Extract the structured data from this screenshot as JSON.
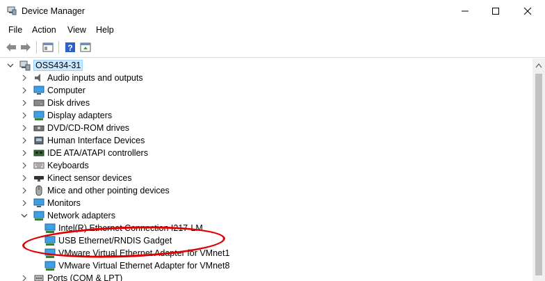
{
  "window": {
    "title": "Device Manager"
  },
  "menubar": {
    "items": [
      "File",
      "Action",
      "View",
      "Help"
    ]
  },
  "toolbar": {
    "buttons": [
      "back-arrow-icon",
      "forward-arrow-icon",
      "properties-icon",
      "help-icon",
      "update-driver-icon"
    ]
  },
  "tree": {
    "root": "OSS434-31",
    "categories": [
      {
        "label": "Audio inputs and outputs",
        "icon": "speaker-icon"
      },
      {
        "label": "Computer",
        "icon": "monitor-icon"
      },
      {
        "label": "Disk drives",
        "icon": "disk-drive-icon"
      },
      {
        "label": "Display adapters",
        "icon": "display-adapter-icon"
      },
      {
        "label": "DVD/CD-ROM drives",
        "icon": "dvd-icon"
      },
      {
        "label": "Human Interface Devices",
        "icon": "hid-icon"
      },
      {
        "label": "IDE ATA/ATAPI controllers",
        "icon": "ide-controller-icon"
      },
      {
        "label": "Keyboards",
        "icon": "keyboard-icon"
      },
      {
        "label": "Kinect sensor devices",
        "icon": "kinect-icon"
      },
      {
        "label": "Mice and other pointing devices",
        "icon": "mouse-icon"
      },
      {
        "label": "Monitors",
        "icon": "monitor-icon"
      },
      {
        "label": "Network adapters",
        "icon": "network-adapter-icon",
        "expanded": true
      }
    ],
    "network_children": [
      "Intel(R) Ethernet Connection I217-LM",
      "USB Ethernet/RNDIS Gadget",
      "VMware Virtual Ethernet Adapter for VMnet1",
      "VMware Virtual Ethernet Adapter for VMnet8"
    ],
    "after": {
      "label": "Ports (COM & LPT)",
      "icon": "port-icon"
    }
  },
  "highlight": {
    "color": "#e00000",
    "target": "USB Ethernet/RNDIS Gadget"
  }
}
